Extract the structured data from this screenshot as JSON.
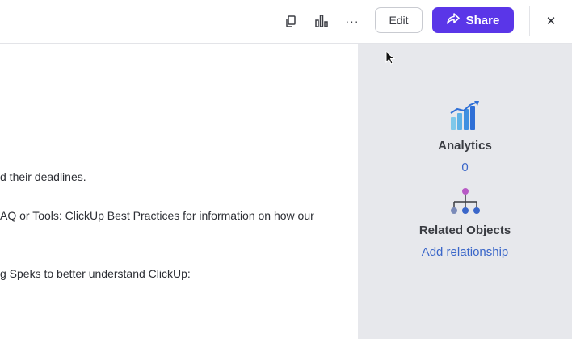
{
  "topbar": {
    "icons": [
      "copy-icon",
      "bar-chart-icon",
      "more-icon",
      "close-icon"
    ],
    "more_glyph": "···",
    "edit_label": "Edit",
    "share_label": "Share",
    "share_color": "#5a36e8",
    "close_glyph": "✕"
  },
  "content": {
    "lines": [
      "d their deadlines.",
      "AQ or Tools: ClickUp Best Practices for information on how our",
      "g Speks to better understand ClickUp:"
    ]
  },
  "sidepanel": {
    "background": "#e7e8ec",
    "analytics": {
      "title": "Analytics",
      "count": "0",
      "icon": "analytics-icon"
    },
    "related": {
      "title": "Related Objects",
      "link": "Add relationship",
      "icon": "hierarchy-icon"
    },
    "link_color": "#3a66c9"
  }
}
